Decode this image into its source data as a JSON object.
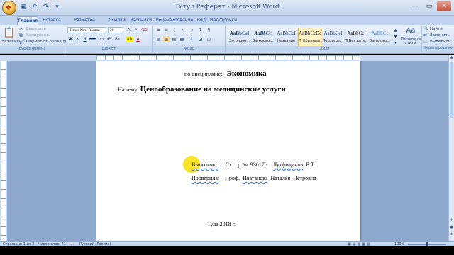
{
  "window": {
    "title": "Титул Реферат - Microsoft Word",
    "office_button_icon": "office-logo-icon",
    "quick_access": [
      "save-icon",
      "undo-icon",
      "redo-icon",
      "qat-customize-icon"
    ],
    "controls": {
      "minimize": "—",
      "maximize": "▭",
      "close": "✕"
    }
  },
  "tabs": [
    {
      "label": "Главная",
      "active": true
    },
    {
      "label": "Вставка"
    },
    {
      "label": "Разметка страницы"
    },
    {
      "label": "Ссылки"
    },
    {
      "label": "Рассылки"
    },
    {
      "label": "Рецензирование"
    },
    {
      "label": "Вид"
    },
    {
      "label": "Надстройки"
    }
  ],
  "ribbon": {
    "clipboard": {
      "label": "Буфер обмена",
      "paste": "Вставить",
      "cut": "Вырезать",
      "copy": "Копировать",
      "format_painter": "Формат по образцу"
    },
    "font": {
      "label": "Шрифт",
      "family": "Times New Roman",
      "size": "20",
      "buttons": [
        "Ж",
        "К",
        "Ч",
        "abc",
        "x₂",
        "x²",
        "Aa"
      ]
    },
    "paragraph": {
      "label": "Абзац"
    },
    "styles": {
      "label": "Стили",
      "items": [
        {
          "sample": "AaBbCel",
          "name": "Заголово..."
        },
        {
          "sample": "AaBbCc",
          "name": "Заголово..."
        },
        {
          "sample": "AaBbCcI",
          "name": "Название"
        },
        {
          "sample": "AaBbCcDc",
          "name": "¶ Обычный",
          "active": true
        },
        {
          "sample": "AaBbCel",
          "name": "Подзагол..."
        },
        {
          "sample": "AaBbCcI",
          "name": "¶ Без инте..."
        },
        {
          "sample": "AaBbCc",
          "name": "Заголово..."
        }
      ],
      "change_styles": "Изменить стили"
    },
    "editing": {
      "label": "Редактирование",
      "find": "Найти",
      "replace": "Заменить",
      "select": "Выделить"
    }
  },
  "document": {
    "discipline_prefix": "по дисциплине:",
    "discipline": "Экономика",
    "topic_prefix": "На тему:",
    "topic": "Ценообразование на медицинские услуги",
    "performed_label": "Выполнил:",
    "performed_group": "Ст. гр.№ 93017р",
    "performed_name": "Лутфидинов",
    "performed_initials": "Б.Т",
    "checked_label": "Проверила:",
    "checked_title": "Проф.",
    "checked_surname": "Иватанова",
    "checked_name": "Наталья",
    "checked_patronymic": "Петровна",
    "city_year": "Тула 2018 г."
  },
  "status": {
    "page": "Страница: 1 из 2",
    "words": "Число слов: 41",
    "language": "Русский (Россия)",
    "zoom": "100%",
    "zoom_level": 0.5
  },
  "colors": {
    "accent": "#15428b",
    "highlight": "#f8de00",
    "spell_underline": "#2f6ed8"
  }
}
